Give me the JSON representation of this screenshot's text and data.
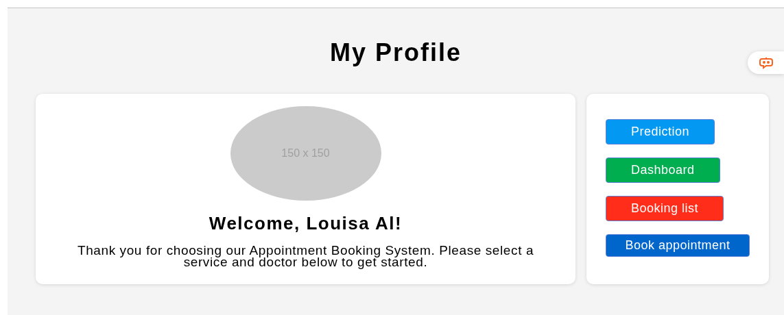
{
  "page_title": "My Profile",
  "profile": {
    "avatar_label": "150 x 150",
    "greeting": "Welcome, Louisa Al!",
    "message": "Thank you for choosing our Appointment Booking System. Please select a service and doctor below to get started."
  },
  "actions": [
    {
      "label": "Prediction",
      "color": "#0399f2"
    },
    {
      "label": "Dashboard",
      "color": "#00ad4f"
    },
    {
      "label": "Booking list",
      "color": "#ff2d1a"
    },
    {
      "label": "Book appointment",
      "color": "#0066cc"
    }
  ]
}
